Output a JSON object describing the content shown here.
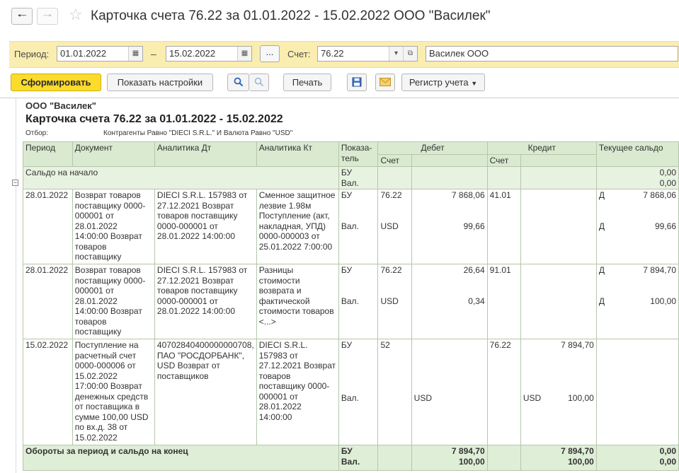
{
  "window": {
    "title": "Карточка счета 76.22 за 01.01.2022 - 15.02.2022 ООО \"Василек\"",
    "back_icon": "arrow-left-icon",
    "forward_icon": "arrow-right-icon",
    "favorite_icon": "star-icon"
  },
  "params": {
    "period_label": "Период:",
    "date_from": "01.01.2022",
    "date_to": "15.02.2022",
    "dash": "–",
    "dots_label": "...",
    "account_label": "Счет:",
    "account_value": "76.22",
    "organization_value": "Василек ООО"
  },
  "toolbar": {
    "generate_label": "Сформировать",
    "settings_label": "Показать настройки",
    "print_label": "Печать",
    "register_label": "Регистр учета"
  },
  "report": {
    "org": "ООО \"Василек\"",
    "title": "Карточка счета 76.22 за 01.01.2022 - 15.02.2022",
    "filter_label": "Отбор:",
    "filter_value": "Контрагенты Равно \"DIECI S.R.L.\" И Валюта Равно \"USD\"",
    "headers": {
      "period": "Период",
      "document": "Документ",
      "analytics_dt": "Аналитика Дт",
      "analytics_kt": "Аналитика Кт",
      "indicator": "Показа-тель",
      "debit": "Дебет",
      "credit": "Кредит",
      "balance": "Текущее сальдо",
      "account": "Счет"
    },
    "opening": {
      "label": "Сальдо на начало",
      "ind1": "БУ",
      "ind2": "Вал.",
      "bal1": "0,00",
      "bal2": "0,00"
    },
    "rows": [
      {
        "date": "28.01.2022",
        "document": "Возврат товаров поставщику 0000-000001 от 28.01.2022 14:00:00 Возврат товаров поставщику",
        "analytics_dt": "DIECI S.R.L. 157983 от 27.12.2021 Возврат товаров поставщику 0000-000001 от 28.01.2022 14:00:00",
        "analytics_kt": "Сменное защитное лезвие 1.98м Поступление (акт, накладная, УПД) 0000-000003 от 25.01.2022 7:00:00",
        "ind1": "БУ",
        "ind2": "Вал.",
        "dt_account": "76.22",
        "dt_currency": "USD",
        "dt_amount": "7 868,06",
        "dt_cur_amount": "99,66",
        "kt_account": "41.01",
        "kt_currency": "",
        "kt_amount": "",
        "kt_cur_amount": "",
        "bal_side1": "Д",
        "bal_side2": "Д",
        "bal1": "7 868,06",
        "bal2": "99,66"
      },
      {
        "date": "28.01.2022",
        "document": "Возврат товаров поставщику 0000-000001 от 28.01.2022 14:00:00 Возврат товаров поставщику",
        "analytics_dt": "DIECI S.R.L. 157983 от 27.12.2021 Возврат товаров поставщику 0000-000001 от 28.01.2022 14:00:00",
        "analytics_kt": "Разницы стоимости возврата и фактической стоимости товаров <...>",
        "ind1": "БУ",
        "ind2": "Вал.",
        "dt_account": "76.22",
        "dt_currency": "USD",
        "dt_amount": "26,64",
        "dt_cur_amount": "0,34",
        "kt_account": "91.01",
        "kt_currency": "",
        "kt_amount": "",
        "kt_cur_amount": "",
        "bal_side1": "Д",
        "bal_side2": "Д",
        "bal1": "7 894,70",
        "bal2": "100,00"
      },
      {
        "date": "15.02.2022",
        "document": "Поступление на расчетный счет 0000-000006 от 15.02.2022 17:00:00 Возврат денежных средств от поставщика в сумме 100,00 USD по вх.д. 38 от 15.02.2022",
        "analytics_dt": "40702840400000000708, ПАО \"РОСДОРБАНК\", USD Возврат от поставщиков",
        "analytics_kt": "DIECI S.R.L. 157983 от 27.12.2021 Возврат товаров поставщику 0000-000001 от 28.01.2022 14:00:00",
        "ind1": "БУ",
        "ind2": "Вал.",
        "dt_account": "52",
        "dt_currency": "USD",
        "dt_amount": "",
        "dt_cur_amount": "",
        "kt_account": "76.22",
        "kt_currency": "USD",
        "kt_amount": "7 894,70",
        "kt_cur_amount": "100,00",
        "bal_side1": "",
        "bal_side2": "",
        "bal1": "",
        "bal2": ""
      }
    ],
    "totals": {
      "label": "Обороты за период и сальдо на конец",
      "ind1": "БУ",
      "ind2": "Вал.",
      "dt1": "7 894,70",
      "dt2": "100,00",
      "kt1": "7 894,70",
      "kt2": "100,00",
      "bal1": "0,00",
      "bal2": "0,00"
    }
  }
}
